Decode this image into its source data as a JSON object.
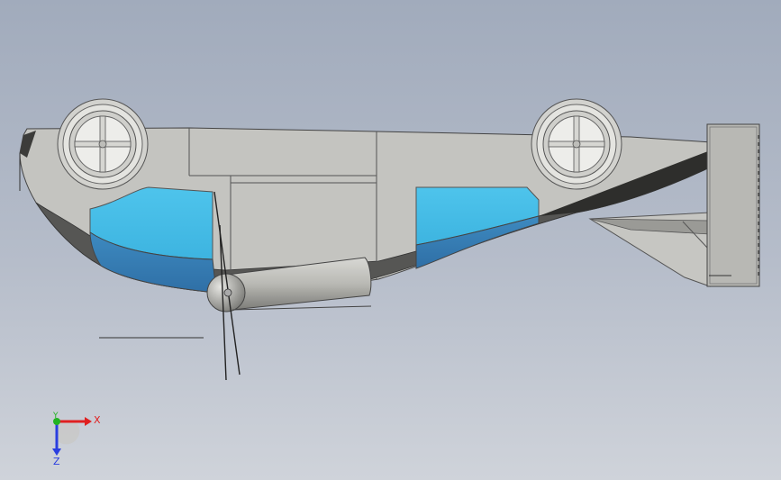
{
  "app": {
    "view": "cad-graphics-area"
  },
  "triad": {
    "x_label": "X",
    "y_label": "Y",
    "z_label": "Z",
    "x_color": "#e02020",
    "y_color": "#22b322",
    "z_color": "#2a3ee0"
  },
  "colors": {
    "background_top": "#a1abbc",
    "background_bottom": "#cfd3da",
    "body_gray": "#c4c4c0",
    "window_cyan": "#45bde8",
    "window_blue": "#3a7fb6",
    "shadow_dark": "#3e3e3c"
  },
  "icons": [
    "wheel-front-icon",
    "wheel-rear-icon",
    "propeller-icon",
    "view-triad-icon"
  ]
}
